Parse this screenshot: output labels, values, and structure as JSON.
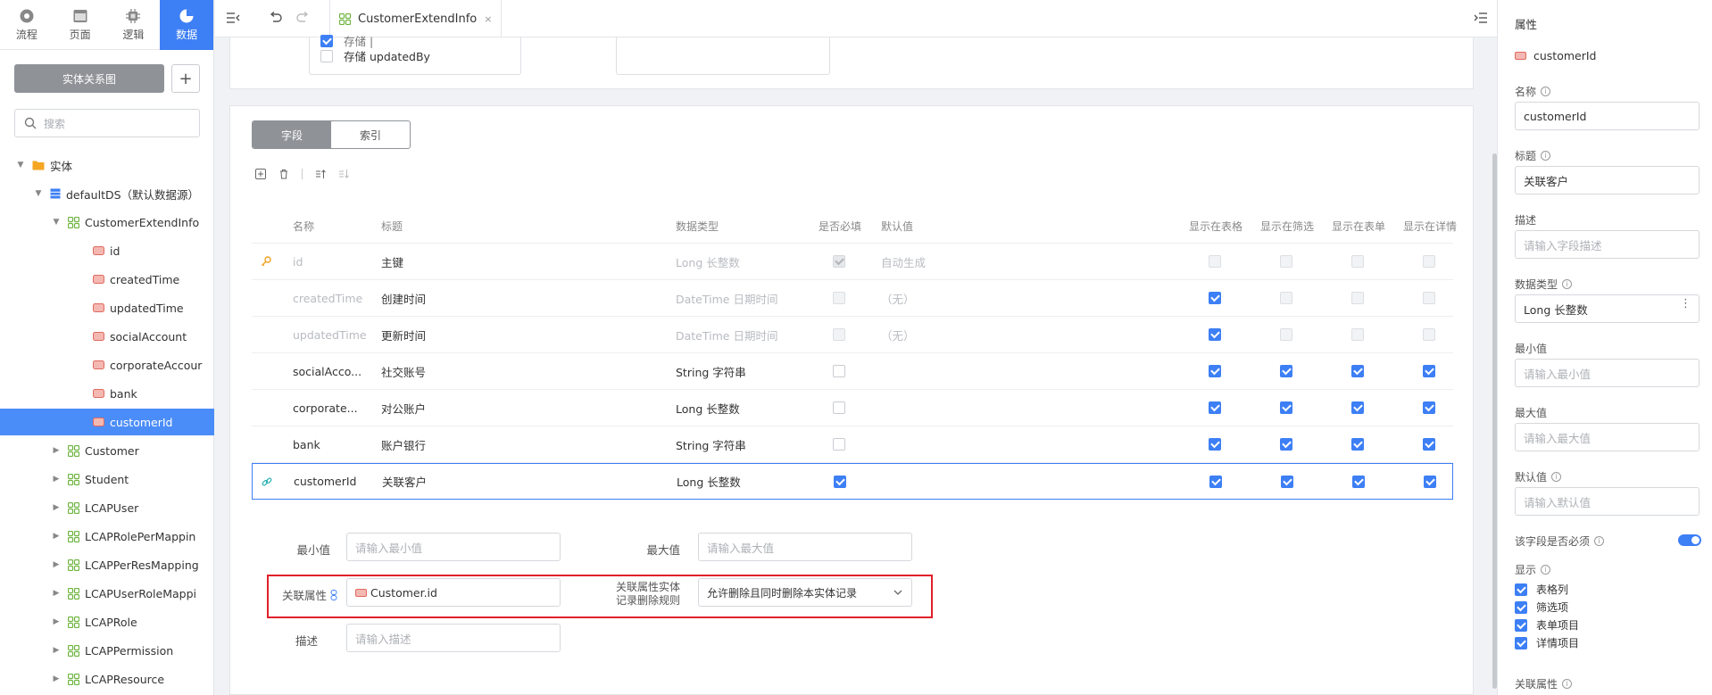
{
  "mode_tabs": [
    {
      "label": "流程",
      "icon": "flow-icon"
    },
    {
      "label": "页面",
      "icon": "page-icon"
    },
    {
      "label": "逻辑",
      "icon": "logic-icon"
    },
    {
      "label": "数据",
      "icon": "data-icon",
      "active": true
    }
  ],
  "sidebar": {
    "er_button": "实体关系图",
    "add_button": "+",
    "search_placeholder": "搜索",
    "tree": [
      {
        "label": "实体",
        "level": 0,
        "caret": "down",
        "icon": "folder-icon"
      },
      {
        "label": "defaultDS（默认数据源）",
        "level": 1,
        "caret": "down",
        "icon": "database-icon"
      },
      {
        "label": "CustomerExtendInfo",
        "level": 2,
        "caret": "down",
        "icon": "entity-icon"
      },
      {
        "label": "id",
        "level": 3,
        "icon": "field-icon"
      },
      {
        "label": "createdTime",
        "level": 3,
        "icon": "field-icon"
      },
      {
        "label": "updatedTime",
        "level": 3,
        "icon": "field-icon"
      },
      {
        "label": "socialAccount",
        "level": 3,
        "icon": "field-icon"
      },
      {
        "label": "corporateAccour",
        "level": 3,
        "icon": "field-icon"
      },
      {
        "label": "bank",
        "level": 3,
        "icon": "field-icon"
      },
      {
        "label": "customerId",
        "level": 3,
        "icon": "field-icon",
        "selected": true
      },
      {
        "label": "Customer",
        "level": 2,
        "caret": "right",
        "icon": "entity-icon"
      },
      {
        "label": "Student",
        "level": 2,
        "caret": "right",
        "icon": "entity-icon"
      },
      {
        "label": "LCAPUser",
        "level": 2,
        "caret": "right",
        "icon": "entity-icon"
      },
      {
        "label": "LCAPRolePerMappin",
        "level": 2,
        "caret": "right",
        "icon": "entity-icon"
      },
      {
        "label": "LCAPPerResMapping",
        "level": 2,
        "caret": "right",
        "icon": "entity-icon"
      },
      {
        "label": "LCAPUserRoleMappi",
        "level": 2,
        "caret": "right",
        "icon": "entity-icon"
      },
      {
        "label": "LCAPRole",
        "level": 2,
        "caret": "right",
        "icon": "entity-icon"
      },
      {
        "label": "LCAPPermission",
        "level": 2,
        "caret": "right",
        "icon": "entity-icon"
      },
      {
        "label": "LCAPResource",
        "level": 2,
        "caret": "right",
        "icon": "entity-icon"
      }
    ]
  },
  "topbar": {
    "tab_label": "CustomerExtendInfo",
    "close": "×"
  },
  "upper_panel": {
    "checkbox_partial_label": "存储 |",
    "checkbox_label": "存储 updatedBy"
  },
  "segment_tabs": [
    "字段",
    "索引"
  ],
  "table": {
    "headers": [
      "名称",
      "标题",
      "数据类型",
      "是否必填",
      "默认值",
      "显示在表格",
      "显示在筛选",
      "显示在表单",
      "显示在详情"
    ],
    "rows": [
      {
        "icon": "key-icon",
        "name": "id",
        "title": "主键",
        "type": "Long 长整数",
        "required": true,
        "default": "自动生成",
        "show": [
          false,
          false,
          false,
          false
        ],
        "dim": true,
        "show_disabled": true
      },
      {
        "icon": "",
        "name": "createdTime",
        "title": "创建时间",
        "type": "DateTime 日期时间",
        "required": false,
        "default": "（无）",
        "show": [
          true,
          false,
          false,
          false
        ],
        "dim": true,
        "show_disabled": false
      },
      {
        "icon": "",
        "name": "updatedTime",
        "title": "更新时间",
        "type": "DateTime 日期时间",
        "required": false,
        "default": "（无）",
        "show": [
          true,
          false,
          false,
          false
        ],
        "dim": true,
        "show_disabled": false
      },
      {
        "icon": "",
        "name": "socialAcco...",
        "title": "社交账号",
        "type": "String 字符串",
        "required": false,
        "default": "",
        "show": [
          true,
          true,
          true,
          true
        ],
        "dim": false
      },
      {
        "icon": "",
        "name": "corporate...",
        "title": "对公账户",
        "type": "Long 长整数",
        "required": false,
        "default": "",
        "show": [
          true,
          true,
          true,
          true
        ],
        "dim": false
      },
      {
        "icon": "",
        "name": "bank",
        "title": "账户银行",
        "type": "String 字符串",
        "required": false,
        "default": "",
        "show": [
          true,
          true,
          true,
          true
        ],
        "dim": false
      },
      {
        "icon": "link-icon",
        "name": "customerId",
        "title": "关联客户",
        "type": "Long 长整数",
        "required": true,
        "default": "",
        "show": [
          true,
          true,
          true,
          true
        ],
        "dim": false,
        "selected": true
      }
    ]
  },
  "detail_form": {
    "min_label": "最小值",
    "min_placeholder": "请输入最小值",
    "max_label": "最大值",
    "max_placeholder": "请输入最大值",
    "relation_label": "关联属性",
    "relation_value": "Customer.id",
    "delete_rule_label_1": "关联属性实体",
    "delete_rule_label_2": "记录删除规则",
    "delete_rule_value": "允许删除且同时删除本实体记录",
    "desc_label": "描述",
    "desc_placeholder": "请输入描述"
  },
  "props": {
    "title": "属性",
    "field_name": "customerId",
    "name_label": "名称",
    "name_value": "customerId",
    "caption_label": "标题",
    "caption_value": "关联客户",
    "desc_label": "描述",
    "desc_placeholder": "请输入字段描述",
    "type_label": "数据类型",
    "type_value": "Long 长整数",
    "min_label": "最小值",
    "min_placeholder": "请输入最小值",
    "max_label": "最大值",
    "max_placeholder": "请输入最大值",
    "default_label": "默认值",
    "default_placeholder": "请输入默认值",
    "required_label": "该字段是否必须",
    "required_on": true,
    "show_label": "显示",
    "show_items": [
      "表格列",
      "筛选项",
      "表单项目",
      "详情项目"
    ],
    "relation_label": "关联属性"
  },
  "colors": {
    "accent": "#3d7ff5",
    "highlight_border": "#e0202a"
  }
}
